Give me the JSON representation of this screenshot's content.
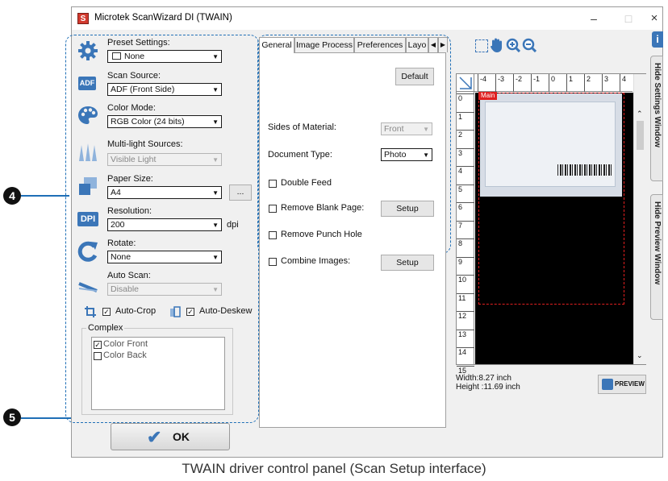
{
  "window": {
    "title": "Microtek ScanWizard DI (TWAIN)",
    "app_icon_glyph": "S",
    "minimize": "–",
    "maximize": "□",
    "close": "×"
  },
  "settings": {
    "preset": {
      "label": "Preset Settings:",
      "value": "None"
    },
    "scan_source": {
      "label": "Scan Source:",
      "value": "ADF (Front Side)",
      "icon_text": "ADF"
    },
    "color_mode": {
      "label": "Color Mode:",
      "value": "RGB Color (24 bits)"
    },
    "multilight": {
      "label": "Multi-light Sources:",
      "value": "Visible Light"
    },
    "paper_size": {
      "label": "Paper Size:",
      "value": "A4",
      "more_button": "..."
    },
    "resolution": {
      "label": "Resolution:",
      "value": "200",
      "unit": "dpi",
      "icon_text": "DPI"
    },
    "rotate": {
      "label": "Rotate:",
      "value": "None"
    },
    "auto_scan": {
      "label": "Auto Scan:",
      "value": "Disable"
    },
    "auto_crop": {
      "label": "Auto-Crop",
      "checked": true
    },
    "auto_deskew": {
      "label": "Auto-Deskew",
      "checked": true
    },
    "complex": {
      "title": "Complex",
      "items": [
        {
          "label": "Color Front",
          "checked": true
        },
        {
          "label": "Color Back",
          "checked": false
        }
      ]
    }
  },
  "ok_button": {
    "label": "OK"
  },
  "tabs": [
    {
      "label": "General",
      "active": true
    },
    {
      "label": "Image Process"
    },
    {
      "label": "Preferences"
    },
    {
      "label": "Layo"
    }
  ],
  "general": {
    "default_button": "Default",
    "sides_of_material": {
      "label": "Sides of Material:",
      "value": "Front"
    },
    "document_type": {
      "label": "Document Type:",
      "value": "Photo"
    },
    "double_feed": {
      "label": "Double Feed",
      "checked": false
    },
    "remove_blank": {
      "label": "Remove Blank Page:",
      "checked": false,
      "button": "Setup"
    },
    "remove_punch": {
      "label": "Remove Punch Hole",
      "checked": false
    },
    "combine_images": {
      "label": "Combine Images:",
      "checked": false,
      "button": "Setup"
    }
  },
  "preview": {
    "ruler_top": [
      "-4",
      "-3",
      "-2",
      "-1",
      "0",
      "1",
      "2",
      "3",
      "4"
    ],
    "ruler_left": [
      "0",
      "1",
      "2",
      "3",
      "4",
      "5",
      "6",
      "7",
      "8",
      "9",
      "10",
      "11",
      "12",
      "13",
      "14",
      "15"
    ],
    "frame_tag": "Main",
    "width_text": "Width:8.27 inch",
    "height_text": "Height :11.69 inch",
    "preview_button": "PREVIEW",
    "hide_settings": "Hide Settings Window",
    "hide_preview": "Hide Preview Window"
  },
  "callouts": {
    "four": "4",
    "five": "5"
  },
  "caption": "TWAIN driver control panel (Scan Setup interface)",
  "colors": {
    "accent_blue": "#1f6fb6",
    "frame_red": "#e01f1f"
  }
}
